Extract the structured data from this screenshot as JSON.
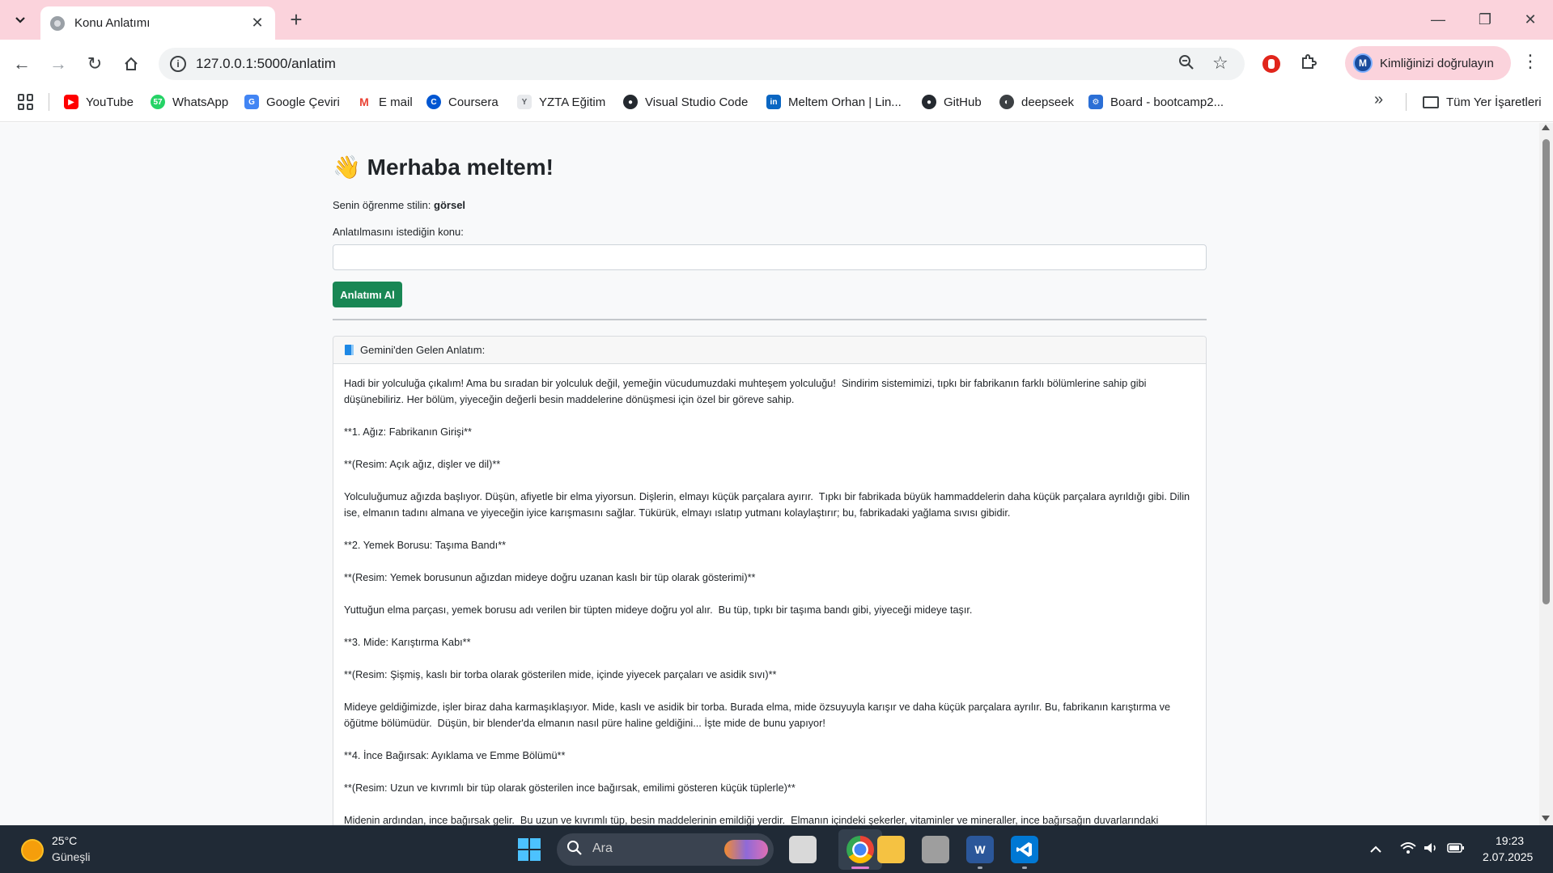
{
  "browser": {
    "tab_title": "Konu Anlatımı",
    "url": "127.0.0.1:5000/anlatim",
    "profile_label": "Kimliğinizi doğrulayın",
    "profile_initial": "M",
    "bookmarks": [
      {
        "label": "YouTube",
        "color": "#ff0000"
      },
      {
        "label": "WhatsApp",
        "color": "#25d366"
      },
      {
        "label": "Google Çeviri",
        "color": "#4285f4"
      },
      {
        "label": "E mail",
        "color": "#ea4335"
      },
      {
        "label": "Coursera",
        "color": "#0056d2"
      },
      {
        "label": "YZTA Eğitim",
        "color": "#5f6368"
      },
      {
        "label": "Visual Studio Code",
        "color": "#24292f"
      },
      {
        "label": "Meltem Orhan | Lin...",
        "color": "#0a66c2"
      },
      {
        "label": "GitHub",
        "color": "#24292f"
      },
      {
        "label": "deepseek",
        "color": "#3c4043"
      },
      {
        "label": "Board - bootcamp2...",
        "color": "#2b6fd6"
      }
    ],
    "all_bookmarks_label": "Tüm Yer İşaretleri"
  },
  "page": {
    "greeting_emoji": "👋",
    "greeting": "Merhaba meltem!",
    "style_prefix": "Senin öğrenme stilin:",
    "style_value": "görsel",
    "topic_label": "Anlatılmasını istediğin konu:",
    "topic_value": "",
    "submit_label": "Anlatımı Al",
    "card_title": "Gemini'den Gelen Anlatım:",
    "paragraphs": [
      "Hadi bir yolculuğa çıkalım! Ama bu sıradan bir yolculuk değil, yemeğin vücudumuzdaki muhteşem yolculuğu!  Sindirim sistemimizi, tıpkı bir fabrikanın farklı bölümlerine sahip gibi düşünebiliriz. Her bölüm, yiyeceğin değerli besin maddelerine dönüşmesi için özel bir göreve sahip.",
      "**1. Ağız: Fabrikanın Girişi**",
      "**(Resim: Açık ağız, dişler ve dil)**",
      "Yolculuğumuz ağızda başlıyor. Düşün, afiyetle bir elma yiyorsun. Dişlerin, elmayı küçük parçalara ayırır.  Tıpkı bir fabrikada büyük hammaddelerin daha küçük parçalara ayrıldığı gibi. Dilin ise, elmanın tadını almana ve yiyeceğin iyice karışmasını sağlar. Tükürük, elmayı ıslatıp yutmanı kolaylaştırır; bu, fabrikadaki yağlama sıvısı gibidir.",
      "**2. Yemek Borusu: Taşıma Bandı**",
      "**(Resim: Yemek borusunun ağızdan mideye doğru uzanan kaslı bir tüp olarak gösterimi)**",
      "Yuttuğun elma parçası, yemek borusu adı verilen bir tüpten mideye doğru yol alır.  Bu tüp, tıpkı bir taşıma bandı gibi, yiyeceği mideye taşır.",
      "**3. Mide: Karıştırma Kabı**",
      "**(Resim: Şişmiş, kaslı bir torba olarak gösterilen mide, içinde yiyecek parçaları ve asidik sıvı)**",
      "Mideye geldiğimizde, işler biraz daha karmaşıklaşıyor. Mide, kaslı ve asidik bir torba. Burada elma, mide özsuyuyla karışır ve daha küçük parçalara ayrılır. Bu, fabrikanın karıştırma ve öğütme bölümüdür.  Düşün, bir blender'da elmanın nasıl püre haline geldiğini... İşte mide de bunu yapıyor!",
      "**4. İnce Bağırsak: Ayıklama ve Emme Bölümü**",
      "**(Resim: Uzun ve kıvrımlı bir tüp olarak gösterilen ince bağırsak, emilimi gösteren küçük tüplerle)**",
      "Midenin ardından, ince bağırsak gelir.  Bu uzun ve kıvrımlı tüp, besin maddelerinin emildiği yerdir.  Elmanın içindeki şekerler, vitaminler ve mineraller, ince bağırsağın duvarlarındaki"
    ]
  },
  "taskbar": {
    "temperature": "25°C",
    "weather": "Güneşli",
    "search_placeholder": "Ara",
    "time": "19:23",
    "date": "2.07.2025"
  }
}
